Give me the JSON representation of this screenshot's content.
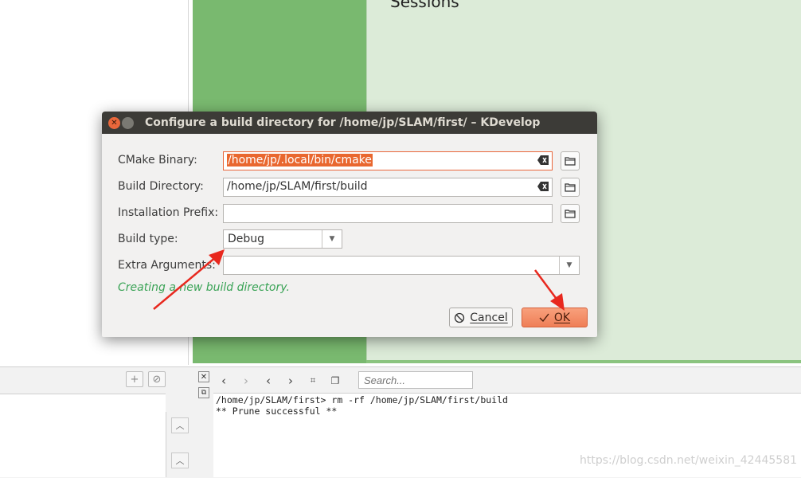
{
  "background": {
    "sessions_title": "Sessions",
    "console": {
      "search_placeholder": "Search...",
      "lines": [
        "/home/jp/SLAM/first> rm -rf /home/jp/SLAM/first/build",
        "** Prune successful **"
      ]
    },
    "watermark": "https://blog.csdn.net/weixin_42445581"
  },
  "dialog": {
    "title": "Configure a build directory for /home/jp/SLAM/first/ – KDevelop",
    "cmake_binary_label": "CMake Binary:",
    "cmake_binary_value": "/home/jp/.local/bin/cmake",
    "build_directory_label": "Build Directory:",
    "build_directory_value": "/home/jp/SLAM/first/build",
    "installation_prefix_label": "Installation Prefix:",
    "installation_prefix_value": "",
    "build_type_label": "Build type:",
    "build_type_value": "Debug",
    "extra_arguments_label": "Extra Arguments:",
    "extra_arguments_value": "",
    "status_message": "Creating a new build directory.",
    "cancel_label": "Cancel",
    "ok_label": "OK"
  },
  "colors": {
    "accent": "#e9673b",
    "titlebar": "#3c3b37",
    "status_green": "#3aa356",
    "annotation_arrow": "#e8281e"
  }
}
